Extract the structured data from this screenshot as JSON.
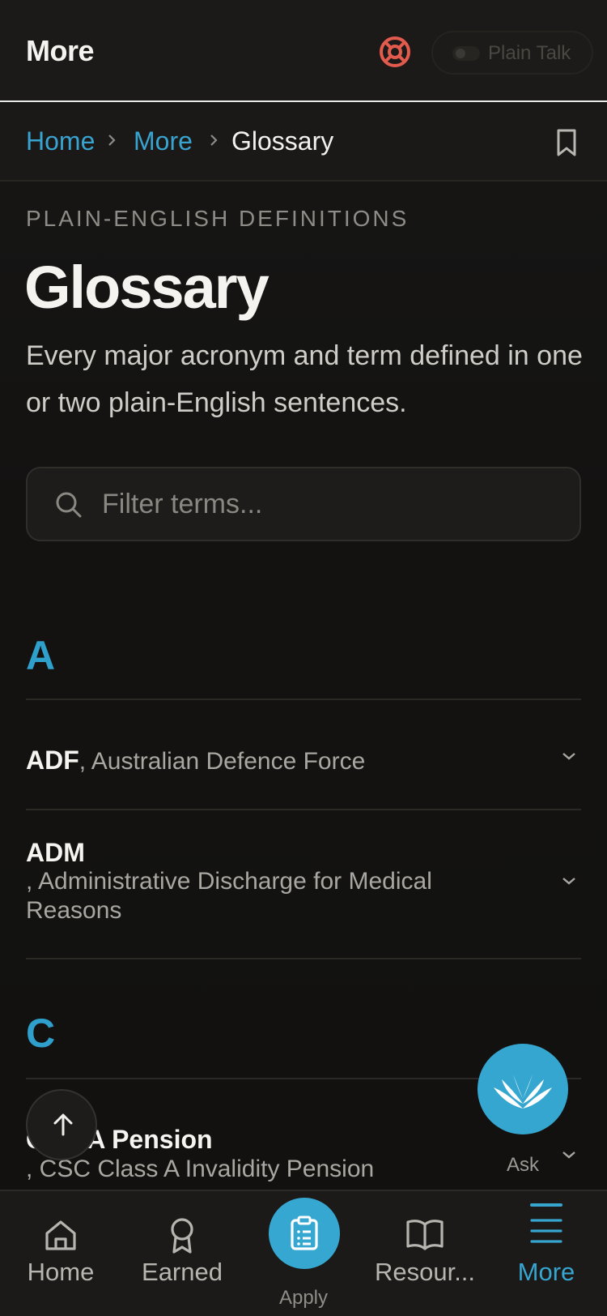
{
  "header": {
    "title": "More",
    "toggle_label": "Plain Talk"
  },
  "breadcrumb": {
    "items": [
      "Home",
      "More",
      "Glossary"
    ]
  },
  "hero": {
    "eyebrow": "PLAIN-ENGLISH DEFINITIONS",
    "title": "Glossary",
    "intro": "Every major acronym and term defined in one or two plain-English sentences."
  },
  "search": {
    "placeholder": "Filter terms..."
  },
  "glossary": {
    "sections": [
      {
        "letter": "A",
        "entries": [
          {
            "term": "ADF",
            "definition": ", Australian Defence Force"
          },
          {
            "term": "ADM",
            "definition": ", Administrative Discharge for Medical Reasons"
          }
        ]
      },
      {
        "letter": "C",
        "entries": [
          {
            "term": "CSC A Pension",
            "definition": ", CSC Class A Invalidity Pension"
          }
        ]
      }
    ]
  },
  "floating": {
    "ask_label": "Ask"
  },
  "bottom_nav": {
    "items": [
      {
        "label": "Home",
        "icon": "home-icon"
      },
      {
        "label": "Earned",
        "icon": "award-icon"
      },
      {
        "label": "Apply",
        "icon": "clipboard-icon"
      },
      {
        "label": "Resour...",
        "icon": "book-icon"
      },
      {
        "label": "More",
        "icon": "menu-icon",
        "active": true
      }
    ]
  },
  "colors": {
    "accent": "#36a5d0",
    "help_icon": "#e35a4e",
    "background": "#131211"
  }
}
